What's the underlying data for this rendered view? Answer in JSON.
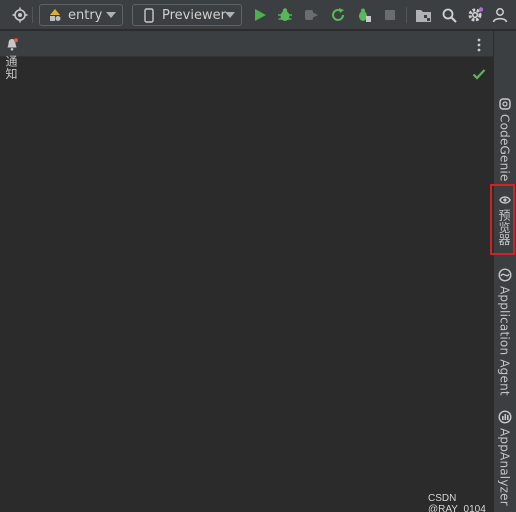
{
  "toolbar": {
    "module_combo": {
      "value": "entry"
    },
    "device_combo": {
      "value": "Previewer"
    },
    "colors": {
      "run": "#4caf50",
      "debug": "#5ab65a"
    }
  },
  "editor": {
    "status_colors": {
      "ok": "#5ab65a"
    }
  },
  "right_strip": {
    "tabs": [
      {
        "label": "通知"
      },
      {
        "label": "CodeGenie"
      },
      {
        "label": "预览器"
      },
      {
        "label": "Application Agent"
      },
      {
        "label": "AppAnalyzer"
      }
    ],
    "highlight_color": "#d32222"
  },
  "watermark": "CSDN @RAY_0104"
}
